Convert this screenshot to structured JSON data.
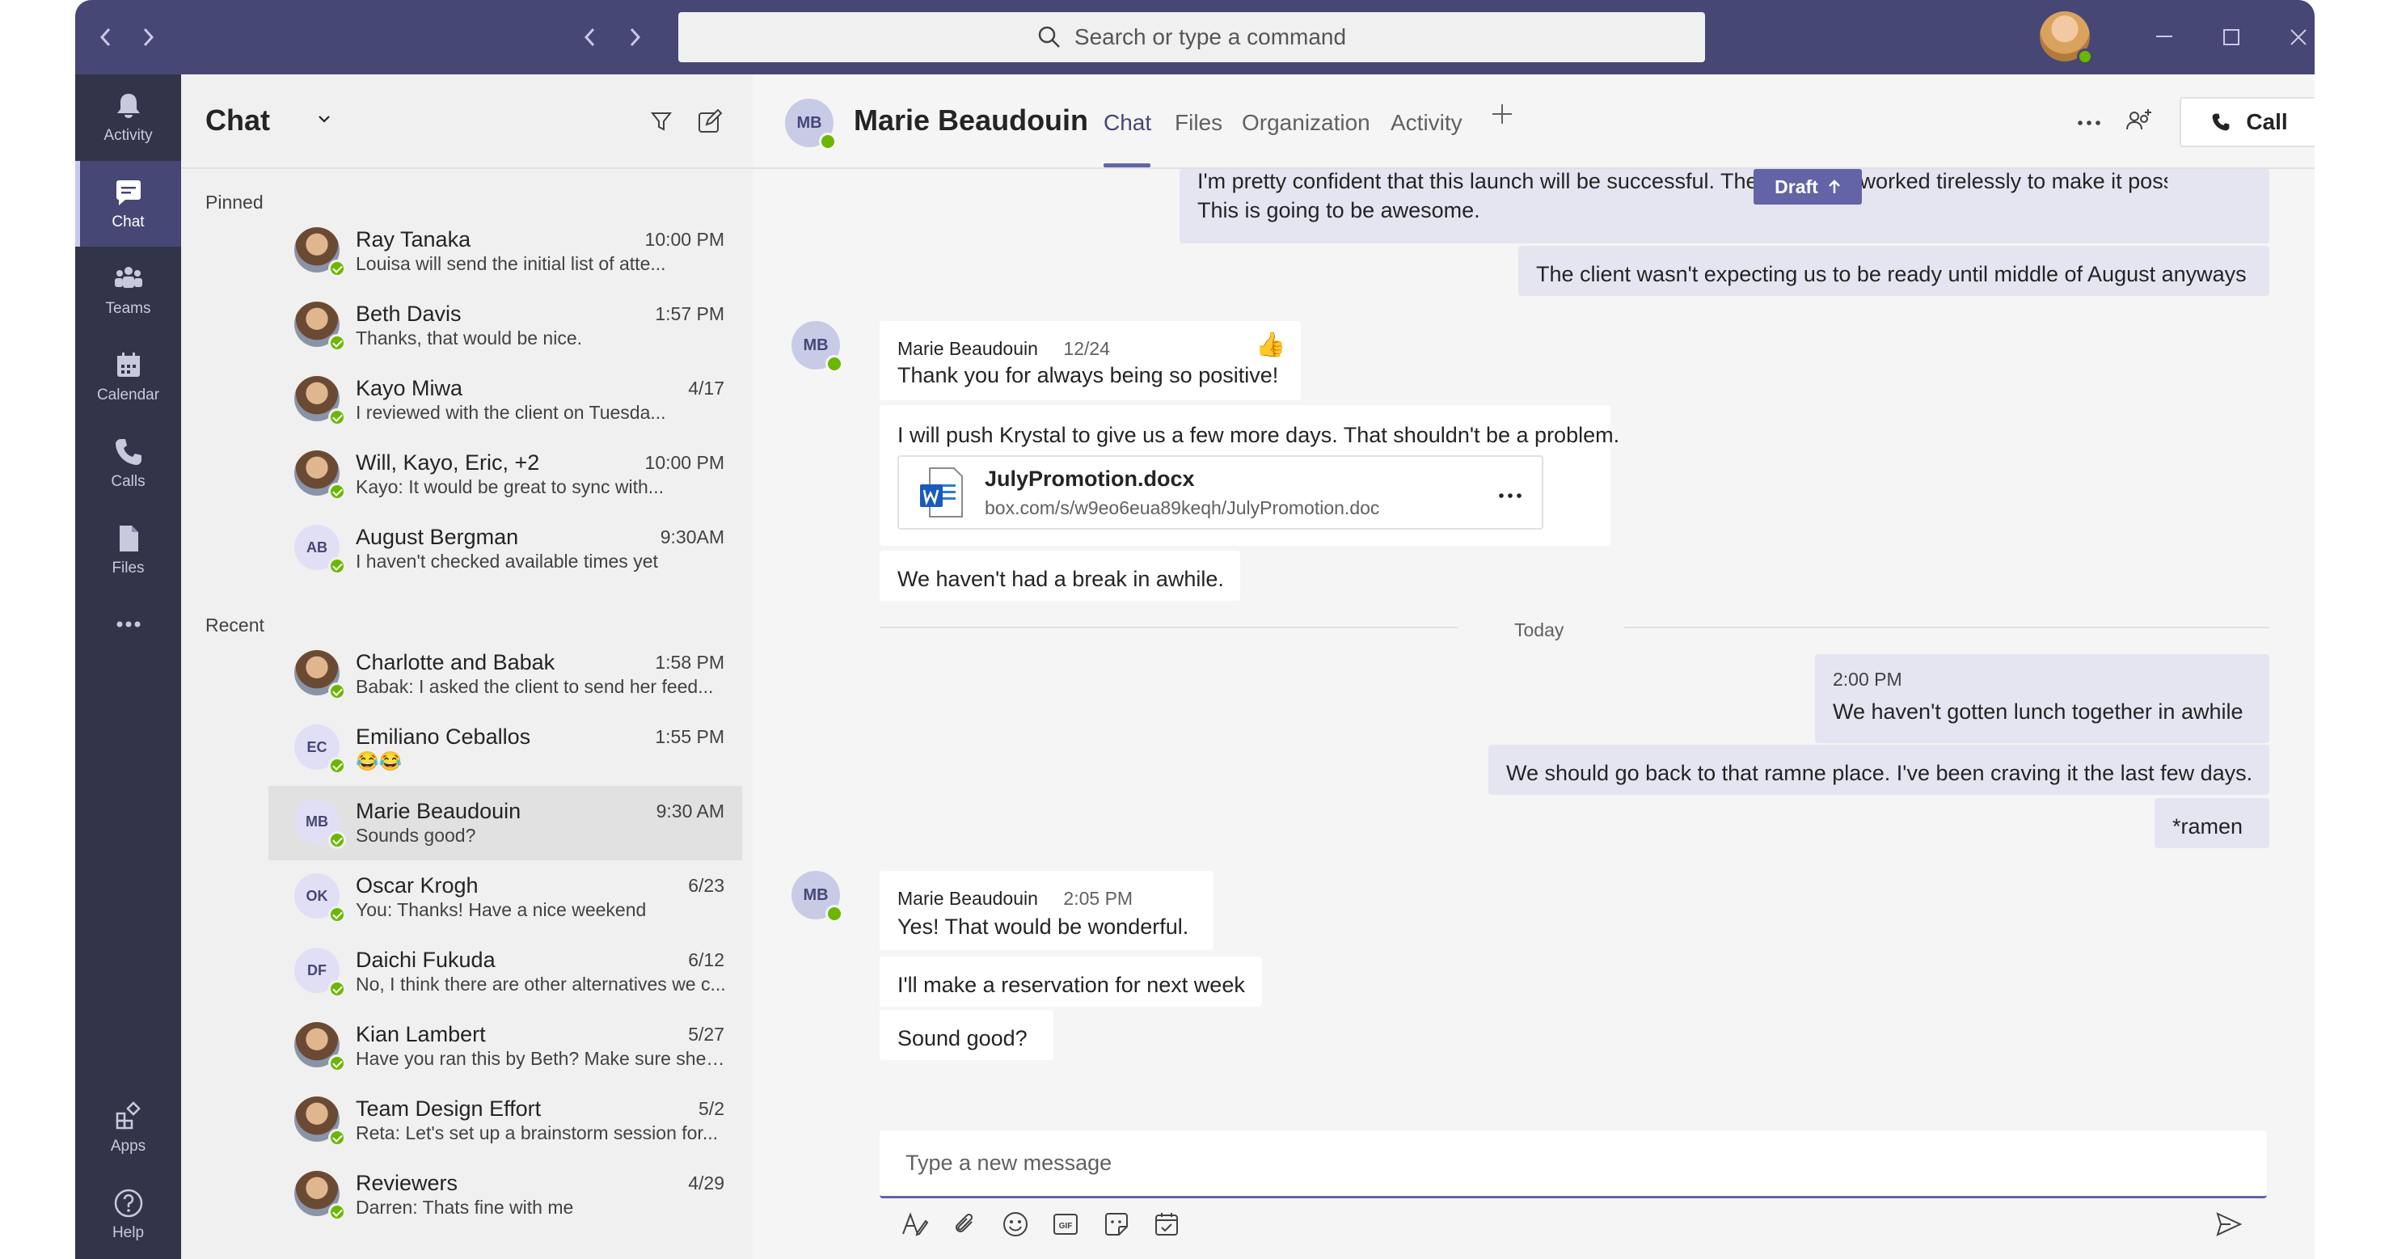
{
  "search": {
    "placeholder": "Search or type a command"
  },
  "appbar": [
    {
      "label": "Activity",
      "icon": "bell-icon"
    },
    {
      "label": "Chat",
      "icon": "chat-icon",
      "active": true
    },
    {
      "label": "Teams",
      "icon": "teams-icon"
    },
    {
      "label": "Calendar",
      "icon": "calendar-icon"
    },
    {
      "label": "Calls",
      "icon": "phone-icon"
    },
    {
      "label": "Files",
      "icon": "file-icon"
    },
    {
      "label": "Apps",
      "icon": "apps-icon"
    },
    {
      "label": "Help",
      "icon": "help-icon"
    }
  ],
  "chatlist": {
    "title": "Chat",
    "pinned_label": "Pinned",
    "recent_label": "Recent",
    "pinned": [
      {
        "name": "Ray Tanaka",
        "time": "10:00 PM",
        "preview": "Louisa will send the initial list of atte...",
        "avatar": "photo"
      },
      {
        "name": "Beth Davis",
        "time": "1:57 PM",
        "preview": "Thanks, that would be nice.",
        "avatar": "photo"
      },
      {
        "name": "Kayo Miwa",
        "time": "4/17",
        "preview": "I reviewed with the client on Tuesda...",
        "avatar": "photo"
      },
      {
        "name": "Will, Kayo, Eric, +2",
        "time": "10:00 PM",
        "preview": "Kayo: It would be great to sync with...",
        "avatar": "photo"
      },
      {
        "name": "August Bergman",
        "time": "9:30AM",
        "preview": "I haven't checked available times yet",
        "initials": "AB"
      }
    ],
    "recent": [
      {
        "name": "Charlotte and Babak",
        "time": "1:58 PM",
        "preview": "Babak: I asked the client to send her feed...",
        "avatar": "photo"
      },
      {
        "name": "Emiliano Ceballos",
        "time": "1:55 PM",
        "preview": "😂😂",
        "initials": "EC"
      },
      {
        "name": "Marie Beaudouin",
        "time": "9:30 AM",
        "preview": "Sounds good?",
        "initials": "MB",
        "selected": true
      },
      {
        "name": "Oscar Krogh",
        "time": "6/23",
        "preview": "You: Thanks! Have a nice weekend",
        "initials": "OK"
      },
      {
        "name": "Daichi Fukuda",
        "time": "6/12",
        "preview": "No, I think there are other alternatives we c...",
        "initials": "DF"
      },
      {
        "name": "Kian Lambert",
        "time": "5/27",
        "preview": "Have you ran this by Beth? Make sure she is...",
        "avatar": "photo"
      },
      {
        "name": "Team Design Effort",
        "time": "5/2",
        "preview": "Reta: Let's set up a brainstorm session for...",
        "avatar": "photo"
      },
      {
        "name": "Reviewers",
        "time": "4/29",
        "preview": "Darren: Thats fine with me",
        "avatar": "photo"
      }
    ]
  },
  "header": {
    "initials": "MB",
    "name": "Marie Beaudouin",
    "tabs": [
      "Chat",
      "Files",
      "Organization",
      "Activity"
    ],
    "call_label": "Call"
  },
  "messages": {
    "sent_1_line1": "I'm pretty confident that this launch will be successful. The team has worked tirelessly to make it possible.",
    "sent_1_line2": "This is going to be awesome.",
    "draft_label": "Draft",
    "sent_2": "The client wasn't expecting us to be ready until middle of August anyways",
    "recv_1_name": "Marie Beaudouin",
    "recv_1_time": "12/24",
    "recv_1_text": "Thank you for always being so positive!",
    "recv_1_reaction": "👍",
    "recv_2_text": "I will push Krystal to give us a few more days. That shouldn't be a problem.",
    "file_name": "JulyPromotion.docx",
    "file_url": "box.com/s/w9eo6eua89keqh/JulyPromotion.doc",
    "recv_3_text": "We haven't had a break in awhile.",
    "today_label": "Today",
    "sent_3_time": "2:00 PM",
    "sent_3_text": "We haven't gotten lunch together in awhile",
    "sent_4_text": "We should go back to that ramne place. I've been craving it the last few days.",
    "sent_5_text": "*ramen",
    "recv_4_name": "Marie Beaudouin",
    "recv_4_time": "2:05 PM",
    "recv_4_text": "Yes! That would be wonderful.",
    "recv_5_text": "I'll make a reservation for next week",
    "recv_6_text": "Sound good?",
    "avatar_initials": "MB"
  },
  "compose": {
    "placeholder": "Type a new message"
  },
  "colors": {
    "brand": "#464775",
    "accent": "#6264a7",
    "presence": "#6bb700"
  }
}
